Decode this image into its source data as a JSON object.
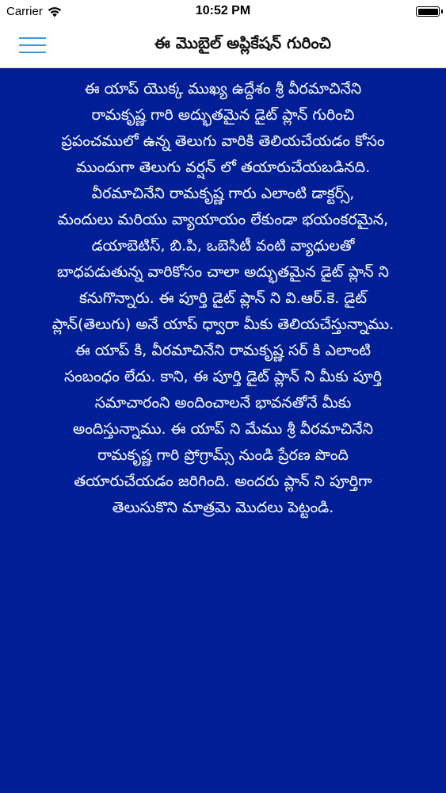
{
  "status_bar": {
    "carrier": "Carrier",
    "time": "10:52 PM",
    "wifi_icon": "wifi-icon",
    "battery_icon": "battery-icon",
    "battery_level": 1.0
  },
  "nav": {
    "menu_icon": "hamburger-menu-icon",
    "accent_color": "#3a9ad9",
    "title": "ఈ మొబైల్ అప్లికేషన్ గురించి"
  },
  "content": {
    "background_color": "#001e96",
    "text_color": "#ffffff",
    "body": "          ఈ యాప్ యొక్క ముఖ్య ఉద్దేశం  శ్రీ వీరమాచినేని\nరామకృష్ణ గారి అద్భుతమైన డైట్ ప్లాన్ గురించి\nప్రపంచములో ఉన్న తెలుగు వారికి తెలియచేయడం కోసం\nముందుగా  తెలుగు వర్షన్ లో తయారుచేయబడినది.\n     వీరమాచినేని రామకృష్ణ గారు ఎలాంటి డాక్టర్స్,\nమందులు మరియు వ్యాయాయం లేకుండా  భయంకరమైన,\nడయాబెటిస్, బి.పి,  ఒబెసిటీ వంటి వ్యాధులతో\nబాధపడుతున్న వారికోసం చాలా  అద్భుతమైన డైట్ ప్లాన్ ని\nకనుగొన్నారు. ఈ పూర్తి డైట్ ప్లాన్ ని వి.ఆర్.కె. డైట్\nప్లాన్(తెలుగు) అనే యాప్ ధ్వారా  మీకు తెలియచేస్తున్నాము.\nఈ యాప్ కి, వీరమాచినేని రామకృష్ణ సర్ కి ఎలాంటి\nసంబంధం లేదు. కాని,  ఈ పూర్తి డైట్ ప్లాన్ ని  మీకు పూర్తి\nసమాచారంని  అందించాలనే భావనతోనే మీకు\nఅందిస్తున్నాము. ఈ యాప్ ని మేము  శ్రీ వీరమాచినేని\nరామకృష్ణ గారి ప్రోగ్రామ్స్  నుండి  ప్రేరణ పొంది\nతయారుచేయడం జరిగింది. అందరు  ప్లాన్ ని పూర్తిగా\nతెలుసుకొని మాత్రమె మొదలు పెట్టండి."
  }
}
